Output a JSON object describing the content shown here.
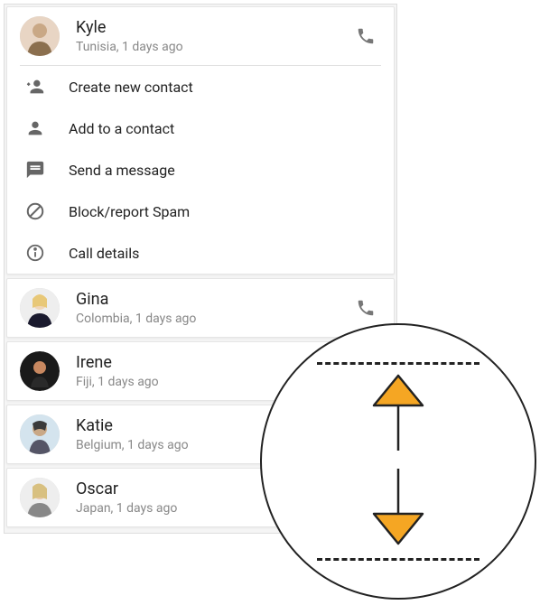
{
  "contacts": [
    {
      "name": "Kyle",
      "sub": "Tunisia, 1 days ago"
    },
    {
      "name": "Gina",
      "sub": "Colombia, 1 days ago"
    },
    {
      "name": "Irene",
      "sub": "Fiji, 1 days ago"
    },
    {
      "name": "Katie",
      "sub": "Belgium, 1 days ago"
    },
    {
      "name": "Oscar",
      "sub": "Japan, 1 days ago"
    }
  ],
  "menu": {
    "create": "Create new contact",
    "add": "Add to a contact",
    "send": "Send a message",
    "block": "Block/report Spam",
    "details": "Call details"
  },
  "colors": {
    "accent": "#f5a623",
    "icon_gray": "#666"
  }
}
